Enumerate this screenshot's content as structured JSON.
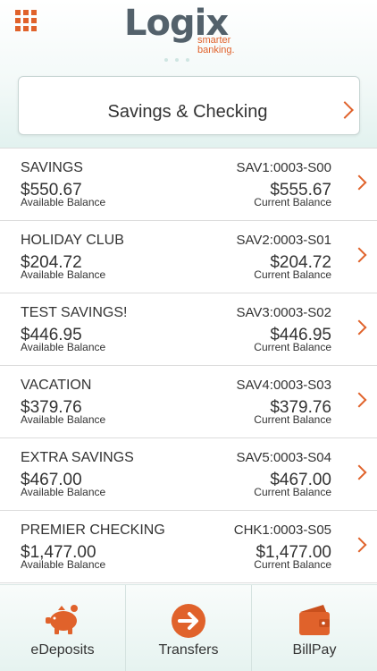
{
  "header": {
    "logo_word": "Logix",
    "logo_tag_line1": "smarter",
    "logo_tag_line2": "banking."
  },
  "selector": {
    "label": "Savings & Checking"
  },
  "accounts": [
    {
      "name": "SAVINGS",
      "id": "SAV1:0003-S00",
      "available": "$550.67",
      "available_label": "Available Balance",
      "current": "$555.67",
      "current_label": "Current Balance"
    },
    {
      "name": "HOLIDAY CLUB",
      "id": "SAV2:0003-S01",
      "available": "$204.72",
      "available_label": "Available Balance",
      "current": "$204.72",
      "current_label": "Current Balance"
    },
    {
      "name": "TEST SAVINGS!",
      "id": "SAV3:0003-S02",
      "available": "$446.95",
      "available_label": "Available Balance",
      "current": "$446.95",
      "current_label": "Current Balance"
    },
    {
      "name": "VACATION",
      "id": "SAV4:0003-S03",
      "available": "$379.76",
      "available_label": "Available Balance",
      "current": "$379.76",
      "current_label": "Current Balance"
    },
    {
      "name": "EXTRA SAVINGS",
      "id": "SAV5:0003-S04",
      "available": "$467.00",
      "available_label": "Available Balance",
      "current": "$467.00",
      "current_label": "Current Balance"
    },
    {
      "name": "PREMIER CHECKING",
      "id": "CHK1:0003-S05",
      "available": "$1,477.00",
      "available_label": "Available Balance",
      "current": "$1,477.00",
      "current_label": "Current Balance"
    }
  ],
  "tabbar": {
    "tabs": [
      {
        "label": "eDeposits",
        "icon": "piggy-bank-icon"
      },
      {
        "label": "Transfers",
        "icon": "arrow-right-circle-icon"
      },
      {
        "label": "BillPay",
        "icon": "wallet-icon"
      }
    ]
  },
  "colors": {
    "accent": "#e0622b",
    "logo_gray": "#53616b",
    "tint": "#e2f2ef"
  }
}
